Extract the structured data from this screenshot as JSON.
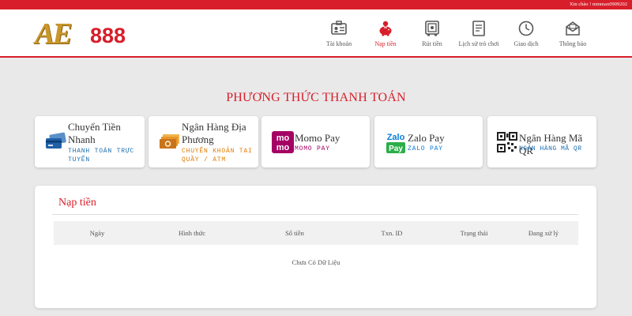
{
  "topbar": {
    "greeting": "Xin chào ! minmax0909202",
    "color": "#d81e2a"
  },
  "brand": {
    "logo_text_ae": "AE",
    "logo_text_num": "888"
  },
  "nav": [
    {
      "label": "Tài khoản",
      "icon": "id-card-icon",
      "active": false
    },
    {
      "label": "Nạp tiền",
      "icon": "piggy-bank-icon",
      "active": true
    },
    {
      "label": "Rút tiền",
      "icon": "safe-icon",
      "active": false
    },
    {
      "label": "Lịch sử trò chơi",
      "icon": "history-icon",
      "active": false
    },
    {
      "label": "Giao dịch",
      "icon": "clock-icon",
      "active": false
    },
    {
      "label": "Thông báo",
      "icon": "mail-icon",
      "active": false
    }
  ],
  "payment": {
    "title": "PHƯƠNG THỨC THANH TOÁN",
    "methods": [
      {
        "name_line1": "Chuyển Tiền",
        "name_line2": "Nhanh",
        "sub_line1": "THANH TOÁN TRỰC",
        "sub_line2": "TUYẾN",
        "icon": "credit-card-icon",
        "sub_color": "#1e6fb0"
      },
      {
        "name_line1": "Ngân Hàng Địa",
        "name_line2": "Phương",
        "sub_line1": "CHUYỂN KHOẢN TẠI",
        "sub_line2": "QUẦY / ATM",
        "icon": "cash-icon",
        "sub_color": "#e07b00"
      },
      {
        "name": "Momo Pay",
        "sub": "MOMO PAY",
        "icon": "momo-logo-icon",
        "logo_line1": "mo",
        "logo_line2": "mo",
        "sub_color": "#a50064"
      },
      {
        "name": "Zalo Pay",
        "sub": "ZALO PAY",
        "icon": "zalopay-logo-icon",
        "logo_line1": "Zalo",
        "logo_line2": "Pay",
        "sub_color": "#0a7cd6"
      },
      {
        "name": "Ngân Hàng Mã QR",
        "sub": "NGÂN HÀNG MÃ QR",
        "icon": "qr-code-icon",
        "sub_color": "#1e6fb0"
      }
    ]
  },
  "deposit": {
    "title": "Nạp tiền",
    "columns": [
      "Ngày",
      "Hình thức",
      "Số tiền",
      "Txn. ID",
      "Trạng thái",
      "Đang xử lý"
    ],
    "empty_text": "Chưa Có Dữ Liệu"
  }
}
